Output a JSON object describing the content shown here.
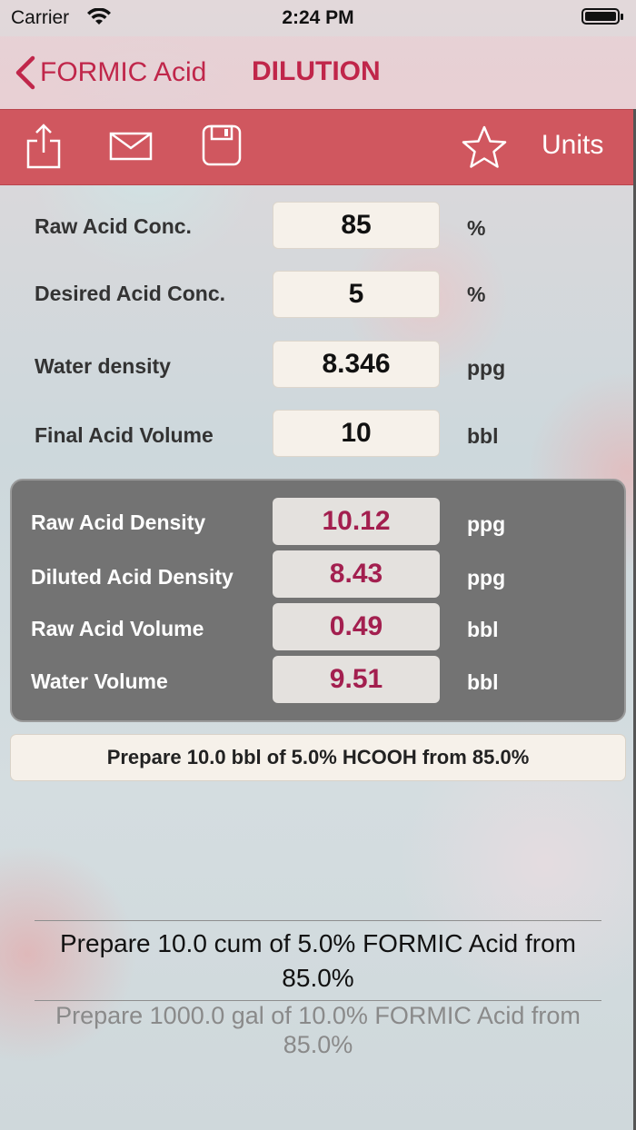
{
  "status_bar": {
    "carrier": "Carrier",
    "time": "2:24 PM"
  },
  "nav": {
    "back_label": "FORMIC Acid",
    "title": "DILUTION"
  },
  "toolbar": {
    "units_label": "Units",
    "icons": [
      "share-icon",
      "mail-icon",
      "save-icon",
      "star-icon"
    ]
  },
  "inputs": [
    {
      "label": "Raw Acid Conc.",
      "value": "85",
      "unit": "%"
    },
    {
      "label": "Desired Acid Conc.",
      "value": "5",
      "unit": "%"
    },
    {
      "label": "Water density",
      "value": "8.346",
      "unit": "ppg"
    },
    {
      "label": "Final Acid Volume",
      "value": "10",
      "unit": "bbl"
    }
  ],
  "results": [
    {
      "label": "Raw Acid Density",
      "value": "10.12",
      "unit": "ppg"
    },
    {
      "label": "Diluted Acid Density",
      "value": "8.43",
      "unit": "ppg"
    },
    {
      "label": "Raw Acid Volume",
      "value": "0.49",
      "unit": "bbl"
    },
    {
      "label": "Water Volume",
      "value": "9.51",
      "unit": "bbl"
    }
  ],
  "summary": "Prepare 10.0 bbl of 5.0% HCOOH from 85.0%",
  "picker": {
    "selected": "Prepare 10.0 cum of 5.0% FORMIC Acid from 85.0%",
    "next": "Prepare 1000.0 gal of 10.0% FORMIC Acid from 85.0%"
  },
  "colors": {
    "accent": "#c0264a",
    "toolbar": "#d0575f",
    "result_value": "#a31f4f",
    "results_panel": "#737373"
  }
}
